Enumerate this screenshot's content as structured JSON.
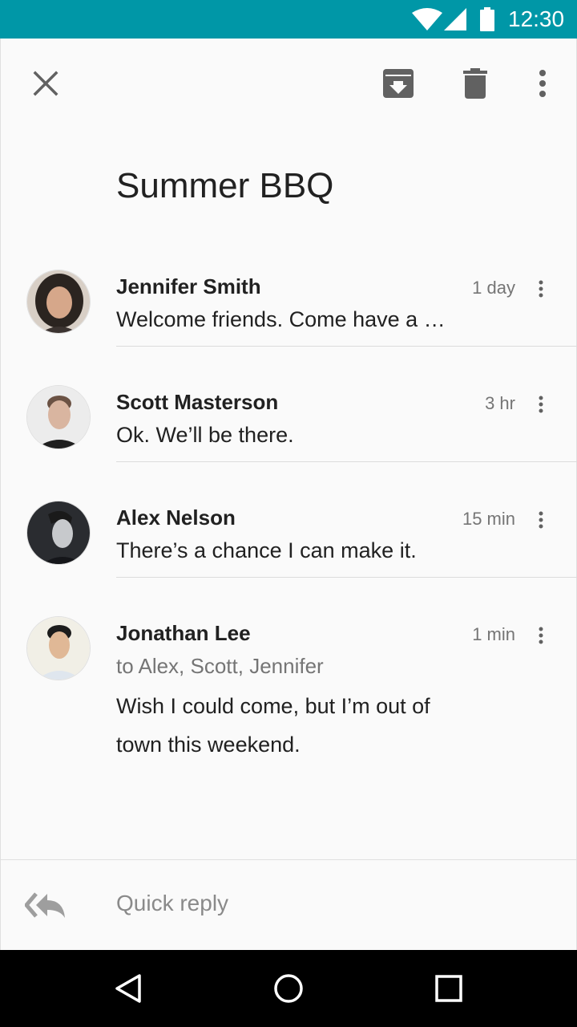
{
  "status_bar": {
    "time": "12:30"
  },
  "toolbar": {
    "close_icon": "close-icon",
    "archive_icon": "archive-icon",
    "delete_icon": "delete-icon",
    "more_icon": "more-vert-icon"
  },
  "subject": "Summer BBQ",
  "messages": [
    {
      "name": "Jennifer Smith",
      "time": "1 day",
      "snippet": "Welcome friends. Come have a …"
    },
    {
      "name": "Scott Masterson",
      "time": "3 hr",
      "snippet": "Ok. We’ll be there."
    },
    {
      "name": "Alex Nelson",
      "time": "15 min",
      "snippet": "There’s a chance I can make it."
    },
    {
      "name": "Jonathan Lee",
      "time": "1 min",
      "recipients": "to Alex, Scott, Jennifer",
      "body": "Wish I could come, but I’m out of town this weekend."
    }
  ],
  "quick_reply": {
    "placeholder": "Quick reply",
    "icon": "reply-all-icon"
  },
  "colors": {
    "status_bar": "#0097a7",
    "background": "#fafafa",
    "primary_text": "#212121",
    "secondary_text": "#757575"
  }
}
